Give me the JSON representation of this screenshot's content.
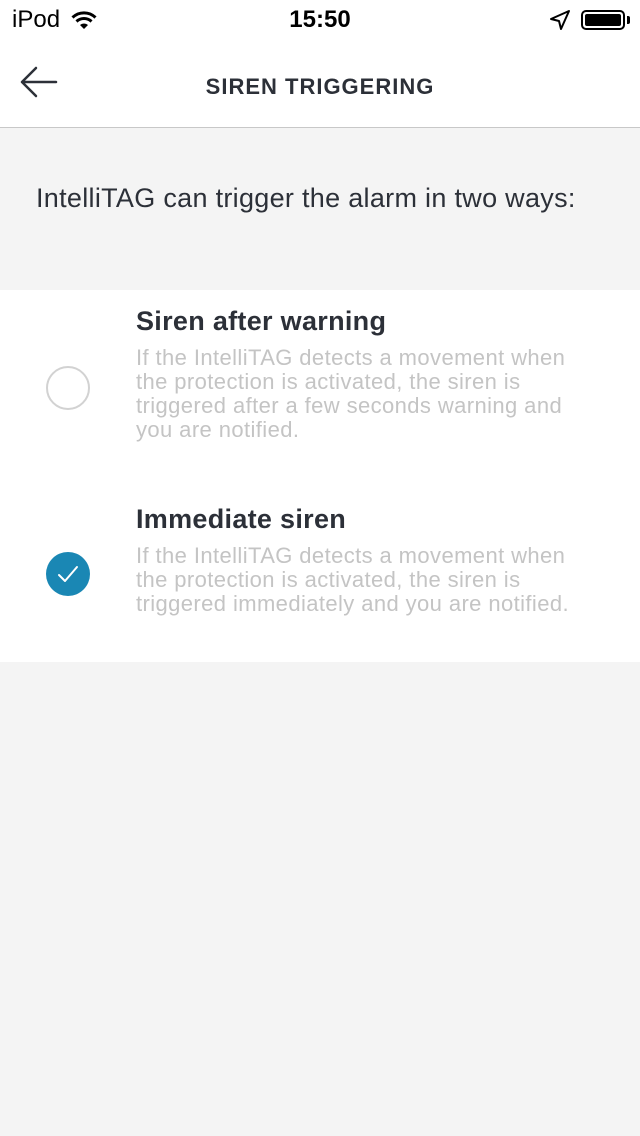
{
  "status_bar": {
    "device": "iPod",
    "time": "15:50",
    "icons": [
      "wifi-icon",
      "location-icon",
      "battery-icon"
    ]
  },
  "header": {
    "title": "SIREN TRIGGERING",
    "back_icon": "back-arrow-icon"
  },
  "intro_text": "IntelliTAG can trigger the alarm in two ways:",
  "options": [
    {
      "title": "Siren after warning",
      "description": "If the IntelliTAG detects a movement when the protection is activated, the siren is triggered after a few seconds warning and you are notified.",
      "selected": false
    },
    {
      "title": "Immediate siren",
      "description": "If the IntelliTAG detects a movement when the protection is activated, the siren is triggered immediately and you are notified.",
      "selected": true
    }
  ],
  "colors": {
    "accent": "#1a87b4",
    "background": "#f4f4f4",
    "text": "#2c3038",
    "muted_text": "#c4c4c4"
  }
}
